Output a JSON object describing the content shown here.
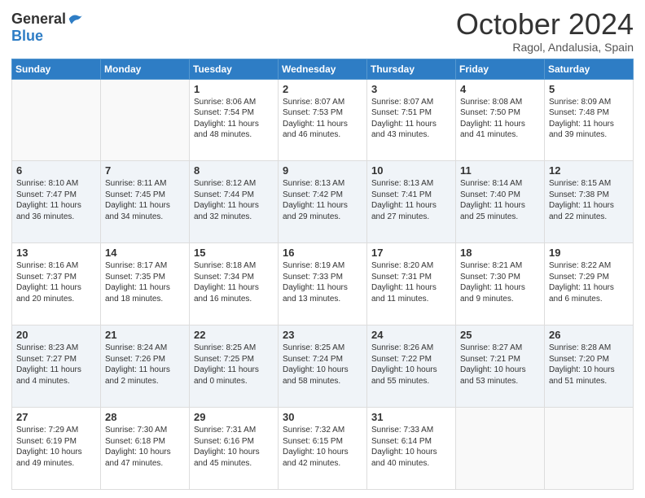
{
  "header": {
    "logo_line1": "General",
    "logo_line2": "Blue",
    "month": "October 2024",
    "location": "Ragol, Andalusia, Spain"
  },
  "days_of_week": [
    "Sunday",
    "Monday",
    "Tuesday",
    "Wednesday",
    "Thursday",
    "Friday",
    "Saturday"
  ],
  "weeks": [
    [
      {
        "day": null,
        "content": null
      },
      {
        "day": null,
        "content": null
      },
      {
        "day": "1",
        "content": "Sunrise: 8:06 AM\nSunset: 7:54 PM\nDaylight: 11 hours and 48 minutes."
      },
      {
        "day": "2",
        "content": "Sunrise: 8:07 AM\nSunset: 7:53 PM\nDaylight: 11 hours and 46 minutes."
      },
      {
        "day": "3",
        "content": "Sunrise: 8:07 AM\nSunset: 7:51 PM\nDaylight: 11 hours and 43 minutes."
      },
      {
        "day": "4",
        "content": "Sunrise: 8:08 AM\nSunset: 7:50 PM\nDaylight: 11 hours and 41 minutes."
      },
      {
        "day": "5",
        "content": "Sunrise: 8:09 AM\nSunset: 7:48 PM\nDaylight: 11 hours and 39 minutes."
      }
    ],
    [
      {
        "day": "6",
        "content": "Sunrise: 8:10 AM\nSunset: 7:47 PM\nDaylight: 11 hours and 36 minutes."
      },
      {
        "day": "7",
        "content": "Sunrise: 8:11 AM\nSunset: 7:45 PM\nDaylight: 11 hours and 34 minutes."
      },
      {
        "day": "8",
        "content": "Sunrise: 8:12 AM\nSunset: 7:44 PM\nDaylight: 11 hours and 32 minutes."
      },
      {
        "day": "9",
        "content": "Sunrise: 8:13 AM\nSunset: 7:42 PM\nDaylight: 11 hours and 29 minutes."
      },
      {
        "day": "10",
        "content": "Sunrise: 8:13 AM\nSunset: 7:41 PM\nDaylight: 11 hours and 27 minutes."
      },
      {
        "day": "11",
        "content": "Sunrise: 8:14 AM\nSunset: 7:40 PM\nDaylight: 11 hours and 25 minutes."
      },
      {
        "day": "12",
        "content": "Sunrise: 8:15 AM\nSunset: 7:38 PM\nDaylight: 11 hours and 22 minutes."
      }
    ],
    [
      {
        "day": "13",
        "content": "Sunrise: 8:16 AM\nSunset: 7:37 PM\nDaylight: 11 hours and 20 minutes."
      },
      {
        "day": "14",
        "content": "Sunrise: 8:17 AM\nSunset: 7:35 PM\nDaylight: 11 hours and 18 minutes."
      },
      {
        "day": "15",
        "content": "Sunrise: 8:18 AM\nSunset: 7:34 PM\nDaylight: 11 hours and 16 minutes."
      },
      {
        "day": "16",
        "content": "Sunrise: 8:19 AM\nSunset: 7:33 PM\nDaylight: 11 hours and 13 minutes."
      },
      {
        "day": "17",
        "content": "Sunrise: 8:20 AM\nSunset: 7:31 PM\nDaylight: 11 hours and 11 minutes."
      },
      {
        "day": "18",
        "content": "Sunrise: 8:21 AM\nSunset: 7:30 PM\nDaylight: 11 hours and 9 minutes."
      },
      {
        "day": "19",
        "content": "Sunrise: 8:22 AM\nSunset: 7:29 PM\nDaylight: 11 hours and 6 minutes."
      }
    ],
    [
      {
        "day": "20",
        "content": "Sunrise: 8:23 AM\nSunset: 7:27 PM\nDaylight: 11 hours and 4 minutes."
      },
      {
        "day": "21",
        "content": "Sunrise: 8:24 AM\nSunset: 7:26 PM\nDaylight: 11 hours and 2 minutes."
      },
      {
        "day": "22",
        "content": "Sunrise: 8:25 AM\nSunset: 7:25 PM\nDaylight: 11 hours and 0 minutes."
      },
      {
        "day": "23",
        "content": "Sunrise: 8:25 AM\nSunset: 7:24 PM\nDaylight: 10 hours and 58 minutes."
      },
      {
        "day": "24",
        "content": "Sunrise: 8:26 AM\nSunset: 7:22 PM\nDaylight: 10 hours and 55 minutes."
      },
      {
        "day": "25",
        "content": "Sunrise: 8:27 AM\nSunset: 7:21 PM\nDaylight: 10 hours and 53 minutes."
      },
      {
        "day": "26",
        "content": "Sunrise: 8:28 AM\nSunset: 7:20 PM\nDaylight: 10 hours and 51 minutes."
      }
    ],
    [
      {
        "day": "27",
        "content": "Sunrise: 7:29 AM\nSunset: 6:19 PM\nDaylight: 10 hours and 49 minutes."
      },
      {
        "day": "28",
        "content": "Sunrise: 7:30 AM\nSunset: 6:18 PM\nDaylight: 10 hours and 47 minutes."
      },
      {
        "day": "29",
        "content": "Sunrise: 7:31 AM\nSunset: 6:16 PM\nDaylight: 10 hours and 45 minutes."
      },
      {
        "day": "30",
        "content": "Sunrise: 7:32 AM\nSunset: 6:15 PM\nDaylight: 10 hours and 42 minutes."
      },
      {
        "day": "31",
        "content": "Sunrise: 7:33 AM\nSunset: 6:14 PM\nDaylight: 10 hours and 40 minutes."
      },
      {
        "day": null,
        "content": null
      },
      {
        "day": null,
        "content": null
      }
    ]
  ]
}
